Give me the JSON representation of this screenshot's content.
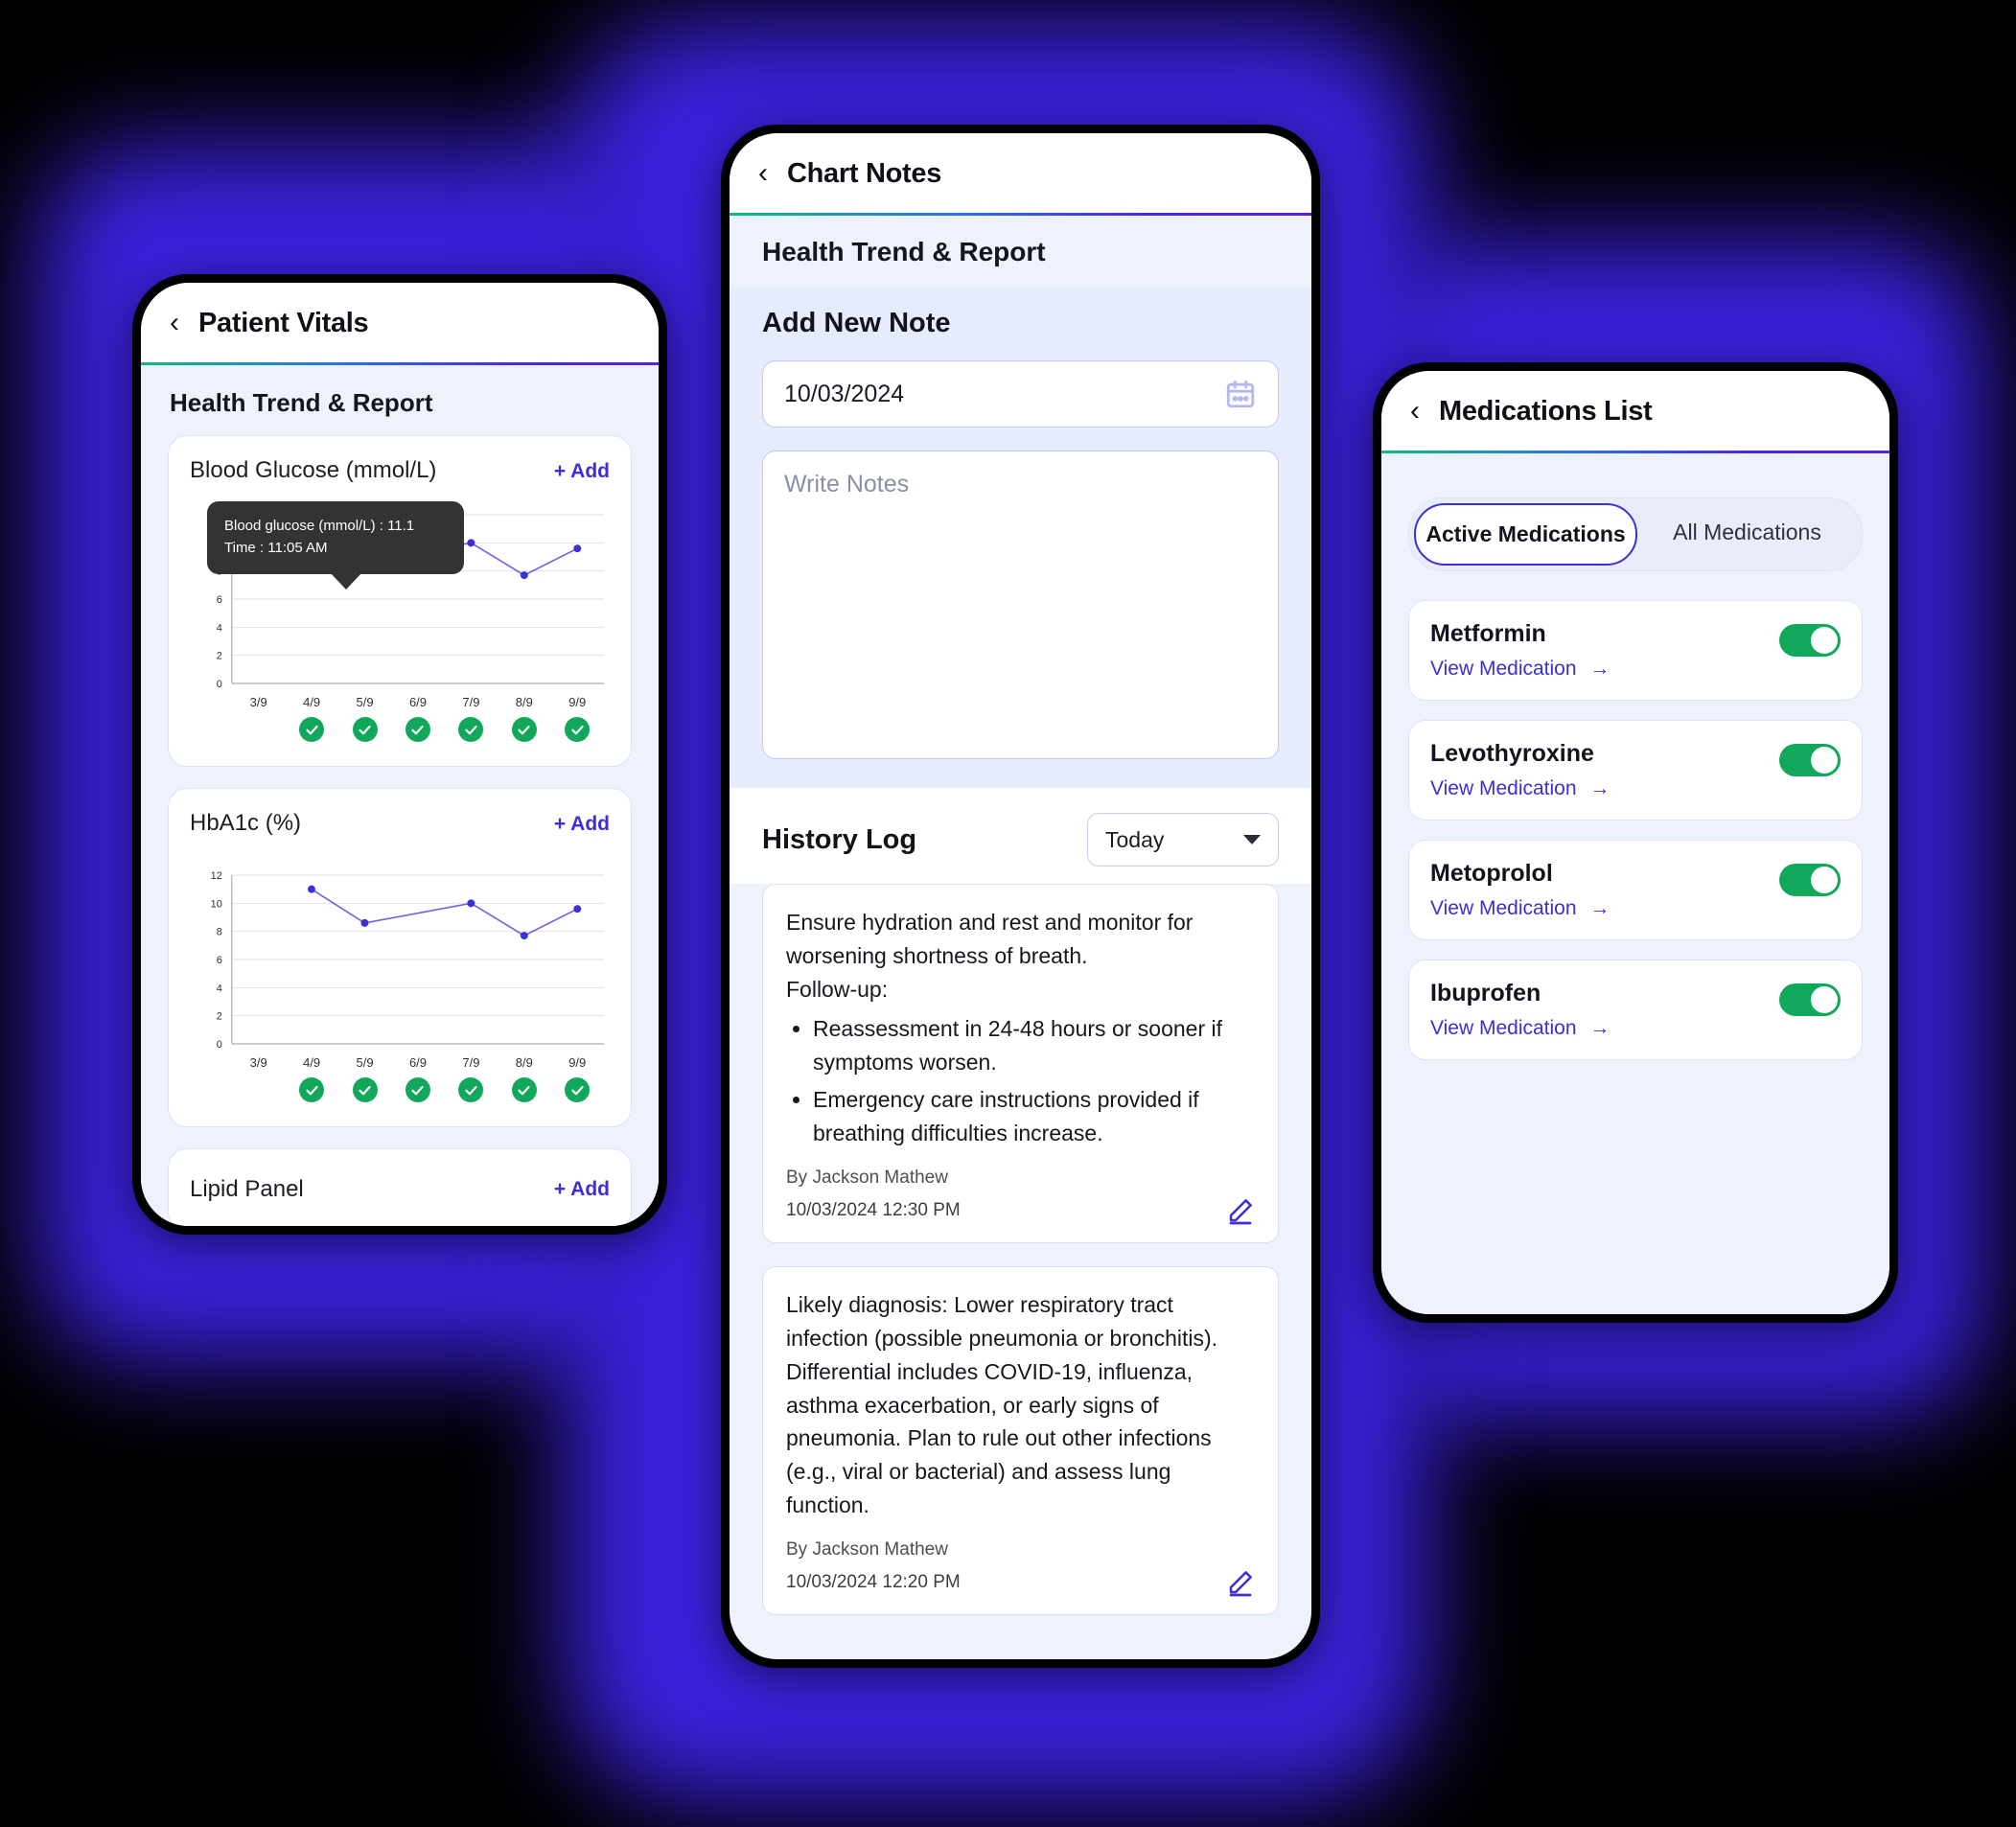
{
  "vitals": {
    "appbar": {
      "back_icon": "chevron-left-icon",
      "title": "Patient Vitals"
    },
    "section_title": "Health Trend & Report",
    "cards": [
      {
        "title": "Blood Glucose (mmol/L)",
        "add_label": "+ Add"
      },
      {
        "title": "HbA1c (%)",
        "add_label": "+ Add"
      },
      {
        "title": "Lipid Panel",
        "add_label": "+ Add"
      }
    ],
    "tooltip": {
      "line1": "Blood glucose (mmol/L) : 11.1",
      "line2": "Time : 11:05 AM"
    }
  },
  "chart_data": [
    {
      "type": "line",
      "title": "Blood Glucose (mmol/L)",
      "x": [
        "3/9",
        "4/9",
        "5/9",
        "6/9",
        "7/9",
        "8/9",
        "9/9"
      ],
      "values": [
        null,
        11.1,
        8.6,
        null,
        10.0,
        7.7,
        9.6
      ],
      "ylim": [
        0,
        12
      ],
      "yticks": [
        0,
        2,
        4,
        6,
        8,
        10,
        12
      ],
      "xlabel": "",
      "ylabel": "",
      "grid": true,
      "legend": "none",
      "series_color": "#3b2fd8",
      "status_marks": [
        false,
        true,
        true,
        true,
        true,
        true,
        true
      ],
      "status_color": "#12a85c"
    },
    {
      "type": "line",
      "title": "HbA1c (%)",
      "x": [
        "3/9",
        "4/9",
        "5/9",
        "6/9",
        "7/9",
        "8/9",
        "9/9"
      ],
      "values": [
        null,
        11.0,
        8.6,
        null,
        10.0,
        7.7,
        9.6
      ],
      "ylim": [
        0,
        12
      ],
      "yticks": [
        0,
        2,
        4,
        6,
        8,
        10,
        12
      ],
      "xlabel": "",
      "ylabel": "",
      "grid": true,
      "legend": "none",
      "series_color": "#3b2fd8",
      "status_marks": [
        false,
        true,
        true,
        true,
        true,
        true,
        true
      ],
      "status_color": "#12a85c"
    }
  ],
  "notes": {
    "appbar": {
      "back_icon": "chevron-left-icon",
      "title": "Chart Notes"
    },
    "section_title": "Health Trend & Report",
    "add_note_title": "Add New Note",
    "date_value": "10/03/2024",
    "calendar_icon": "calendar-icon",
    "notes_placeholder": "Write Notes",
    "history_title": "History Log",
    "history_filter": "Today",
    "entries": [
      {
        "text": "Ensure hydration and rest and monitor for worsening shortness of breath.",
        "subhead": "Follow-up:",
        "bullets": [
          "Reassessment in 24-48 hours or sooner if symptoms worsen.",
          "Emergency care instructions provided if breathing difficulties increase."
        ],
        "author": "By Jackson Mathew",
        "timestamp": "10/03/2024 12:30 PM",
        "edit_icon": "pencil-icon"
      },
      {
        "text": "Likely diagnosis: Lower respiratory tract infection (possible pneumonia or bronchitis). Differential includes COVID-19, influenza, asthma exacerbation, or early signs of pneumonia. Plan to rule out other infections (e.g., viral or bacterial) and assess lung function.",
        "subhead": "",
        "bullets": [],
        "author": "By Jackson Mathew",
        "timestamp": "10/03/2024 12:20 PM",
        "edit_icon": "pencil-icon"
      }
    ]
  },
  "medications": {
    "appbar": {
      "back_icon": "chevron-left-icon",
      "title": "Medications List"
    },
    "tabs": [
      {
        "label": "Active Medications",
        "active": true
      },
      {
        "label": "All Medications",
        "active": false
      }
    ],
    "items": [
      {
        "name": "Metformin",
        "link": "View Medication",
        "arrow": "→",
        "enabled": true
      },
      {
        "name": "Levothyroxine",
        "link": "View Medication",
        "arrow": "→",
        "enabled": true
      },
      {
        "name": "Metoprolol",
        "link": "View Medication",
        "arrow": "→",
        "enabled": true
      },
      {
        "name": "Ibuprofen",
        "link": "View Medication",
        "arrow": "→",
        "enabled": true
      }
    ]
  },
  "colors": {
    "accent": "#3b2fd8",
    "glow": "#3b21dd",
    "success": "#12a85c",
    "surface": "#eef2fd"
  }
}
